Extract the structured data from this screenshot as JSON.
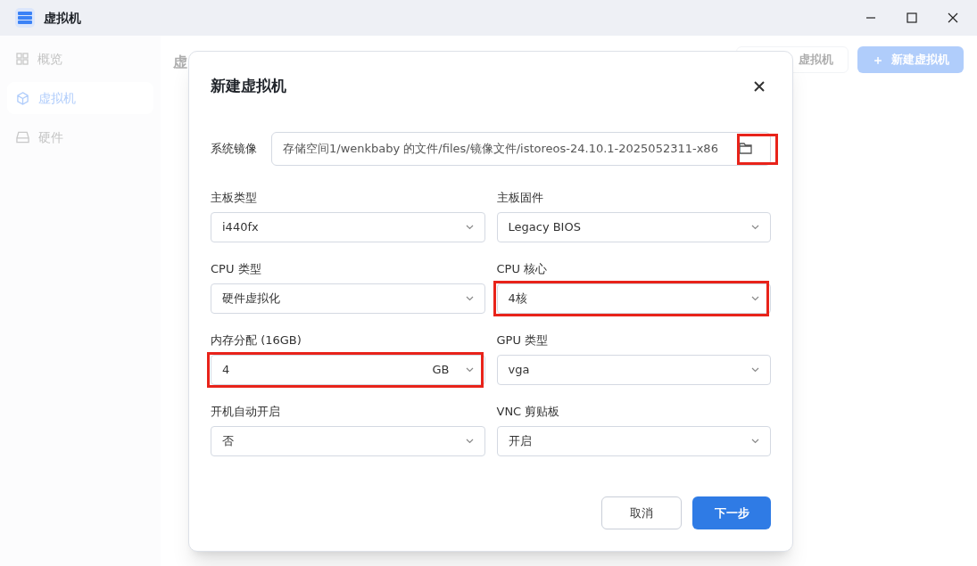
{
  "window": {
    "title": "虚拟机"
  },
  "sidebar": {
    "items": [
      {
        "label": "概览",
        "selected": false
      },
      {
        "label": "虚拟机",
        "selected": true
      },
      {
        "label": "硬件",
        "selected": false
      }
    ]
  },
  "page": {
    "heading": "虚",
    "buttons": [
      {
        "label": "虚拟机",
        "kind": "outline"
      },
      {
        "label": "新建虚拟机",
        "kind": "primary",
        "icon": "＋"
      }
    ]
  },
  "dialog": {
    "title": "新建虚拟机",
    "image": {
      "label": "系统镜像",
      "value": "存储空间1/wenkbaby 的文件/files/镜像文件/istoreos-24.10.1-2025052311-x86",
      "highlighted": true
    },
    "fields": [
      {
        "label": "主板类型",
        "value": "i440fx",
        "highlighted": false
      },
      {
        "label": "主板固件",
        "value": "Legacy BIOS",
        "highlighted": false
      },
      {
        "label": "CPU 类型",
        "value": "硬件虚拟化",
        "highlighted": false
      },
      {
        "label": "CPU 核心",
        "value": "4核",
        "highlighted": true
      },
      {
        "label": "内存分配 (16GB)",
        "value": "4",
        "unit": "GB",
        "highlighted": true
      },
      {
        "label": "GPU 类型",
        "value": "vga",
        "highlighted": false
      },
      {
        "label": "开机自动开启",
        "value": "否",
        "highlighted": false
      },
      {
        "label": "VNC 剪贴板",
        "value": "开启",
        "highlighted": false
      }
    ],
    "buttons": [
      {
        "label": "取消",
        "kind": "secondary"
      },
      {
        "label": "下一步",
        "kind": "primary"
      }
    ]
  }
}
